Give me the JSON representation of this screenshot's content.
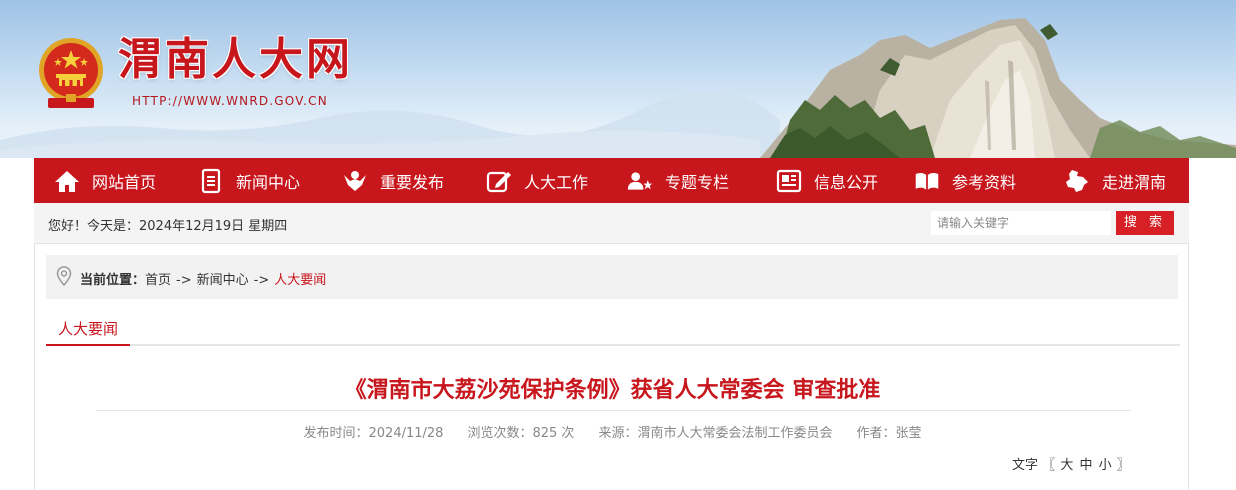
{
  "site": {
    "title": "渭南人大网",
    "url": "HTTP://WWW.WNRD.GOV.CN"
  },
  "nav": [
    {
      "label": "网站首页",
      "icon": "home-icon"
    },
    {
      "label": "新闻中心",
      "icon": "document-icon"
    },
    {
      "label": "重要发布",
      "icon": "announce-icon"
    },
    {
      "label": "人大工作",
      "icon": "edit-icon"
    },
    {
      "label": "专题专栏",
      "icon": "user-star-icon"
    },
    {
      "label": "信息公开",
      "icon": "newspaper-icon"
    },
    {
      "label": "参考资料",
      "icon": "book-icon"
    },
    {
      "label": "走进渭南",
      "icon": "map-icon"
    }
  ],
  "infobar": {
    "greeting": "您好！今天是：2024年12月19日 星期四",
    "search_placeholder": "请输入关键字",
    "search_button": "搜 索"
  },
  "breadcrumb": {
    "label": "当前位置：",
    "items": [
      "首页",
      "新闻中心",
      "人大要闻"
    ],
    "separator": "->"
  },
  "tab": {
    "label": "人大要闻"
  },
  "article": {
    "title": "《渭南市大荔沙苑保护条例》获省人大常委会 审查批准",
    "publish_label": "发布时间：",
    "publish_date": "2024/11/28",
    "views_label": "浏览次数：",
    "views": "825",
    "views_unit": "次",
    "source_label": "来源：",
    "source": "渭南市人大常委会法制工作委员会",
    "author_label": "作者：",
    "author": "张莹"
  },
  "font_size": {
    "label": "文字",
    "open_bracket": "〖",
    "large": "大",
    "medium": "中",
    "small": "小",
    "close_bracket": "〗"
  },
  "colors": {
    "brand_red": "#c8161d",
    "search_red": "#d71f26",
    "infobar_bg": "#f4f4f4"
  }
}
